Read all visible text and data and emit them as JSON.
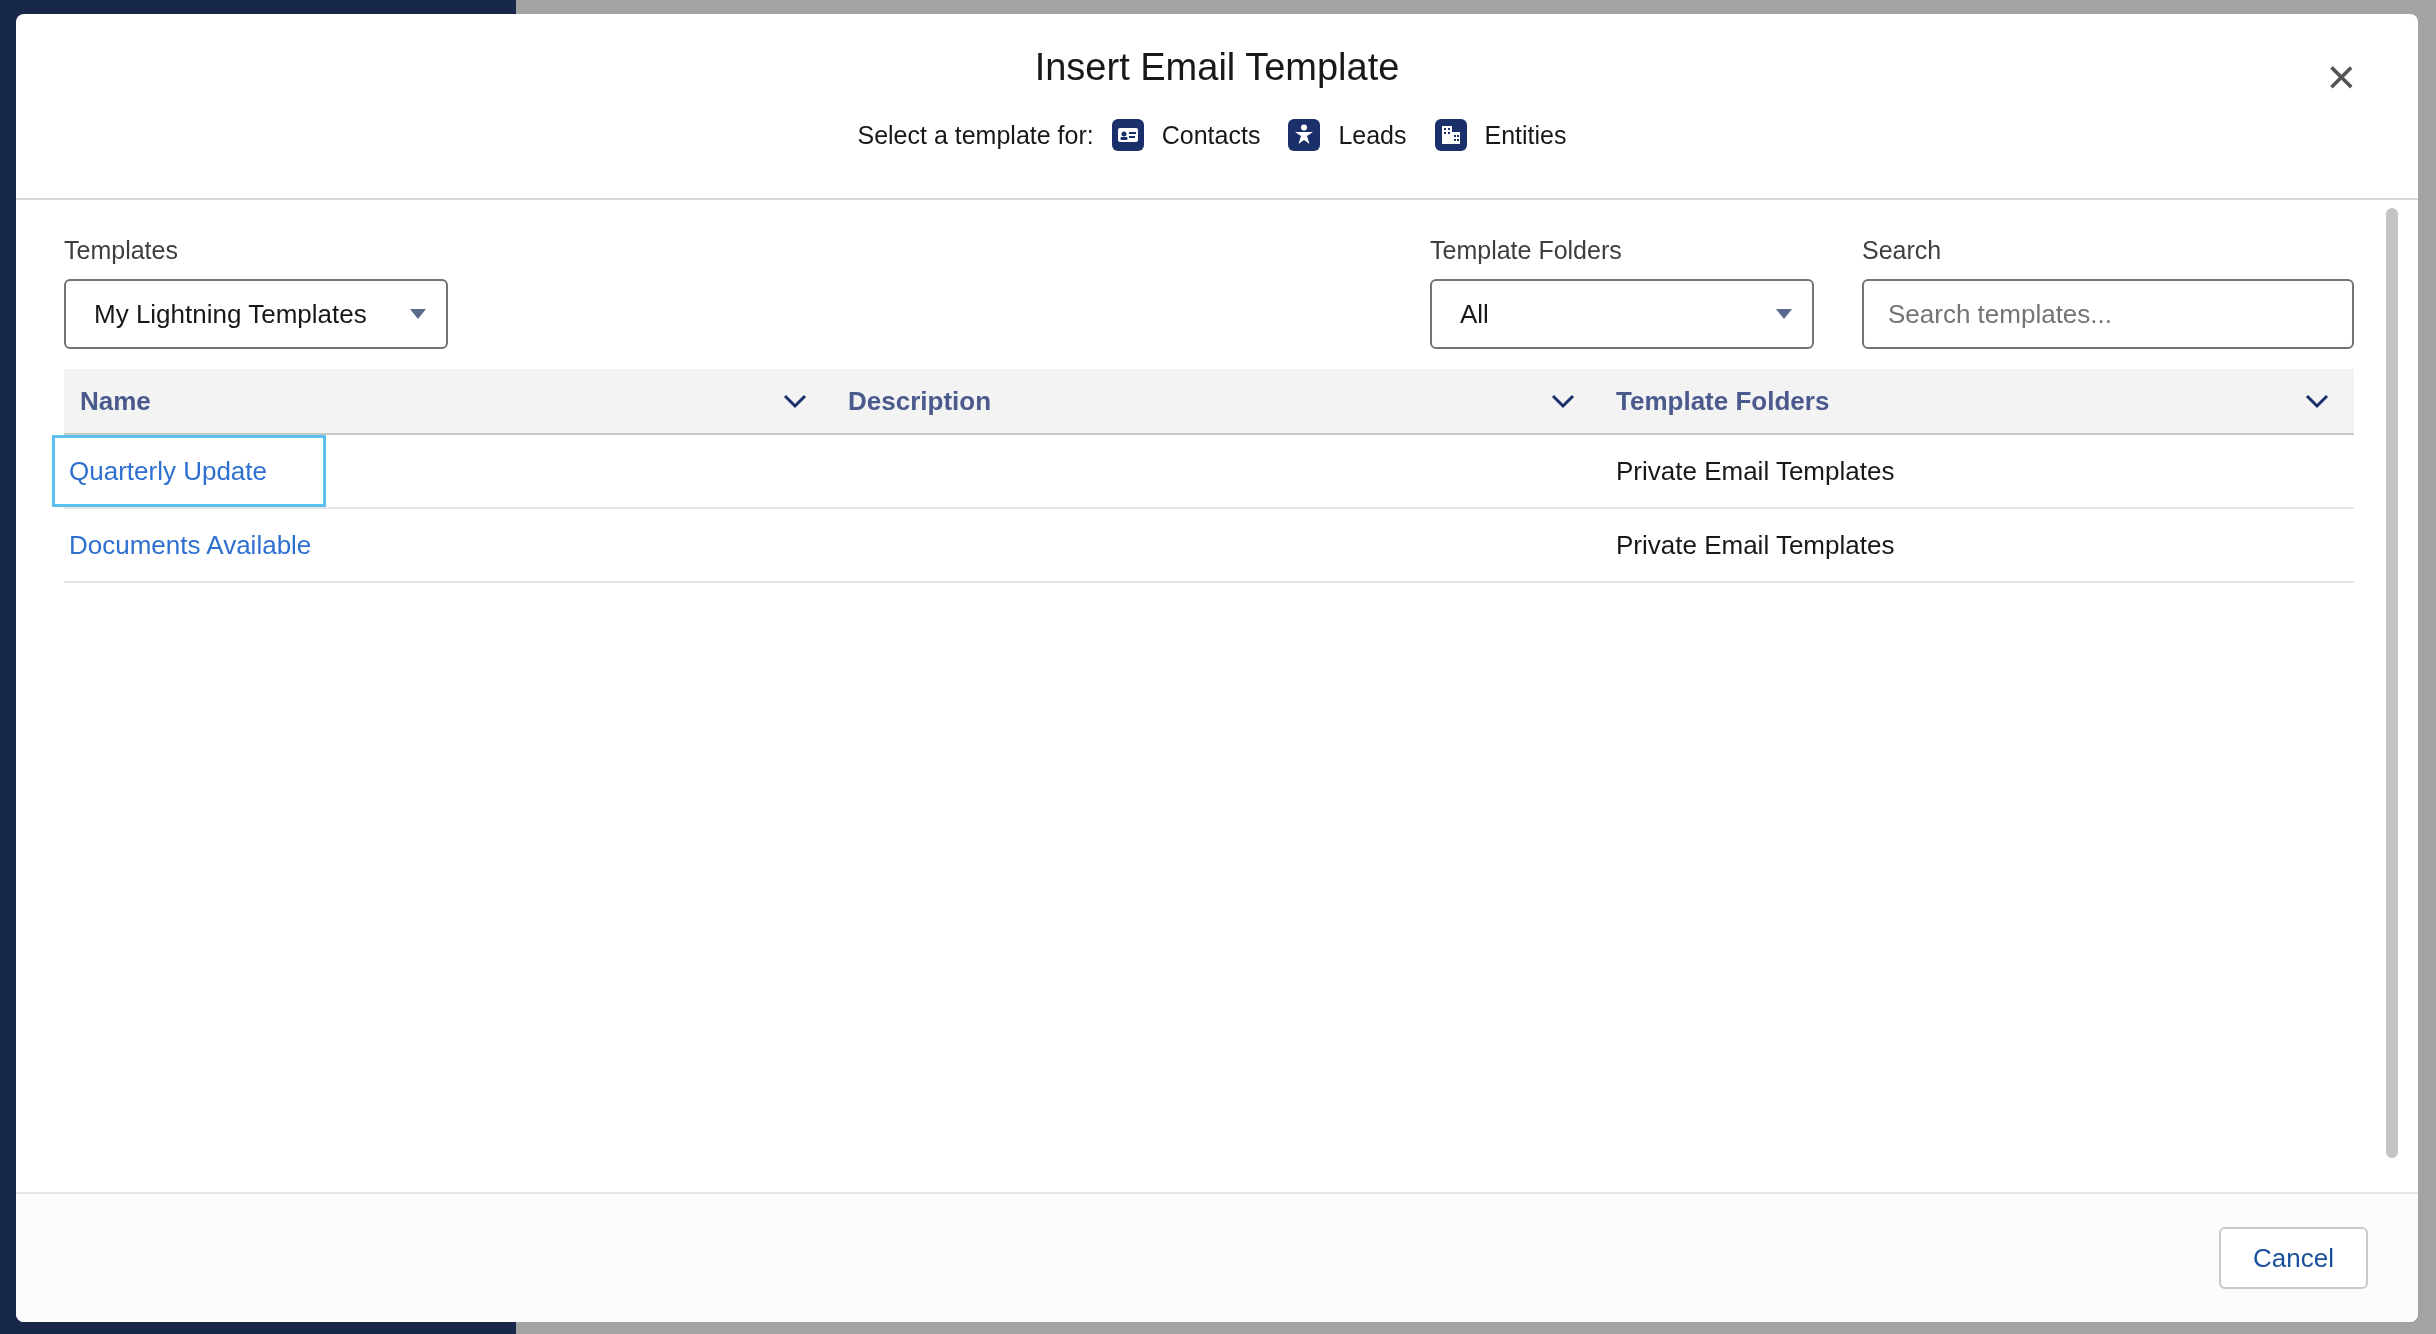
{
  "modal": {
    "title": "Insert Email Template",
    "close": "×",
    "subtitle": {
      "label": "Select a template for:",
      "objects": [
        {
          "kind": "contact",
          "label": "Contacts"
        },
        {
          "kind": "lead",
          "label": "Leads"
        },
        {
          "kind": "entity",
          "label": "Entities"
        }
      ]
    }
  },
  "filters": {
    "templates": {
      "label": "Templates",
      "value": "My Lightning Templates"
    },
    "folders": {
      "label": "Template Folders",
      "value": "All"
    },
    "search": {
      "label": "Search",
      "placeholder": "Search templates..."
    }
  },
  "table": {
    "columns": [
      "Name",
      "Description",
      "Template Folders"
    ],
    "rows": [
      {
        "name": "Quarterly Update",
        "folder": "Private Email Templates",
        "focused": true
      },
      {
        "name": "Documents Available",
        "folder": "Private Email Templates",
        "focused": false
      }
    ]
  },
  "footer": {
    "cancel": "Cancel"
  }
}
